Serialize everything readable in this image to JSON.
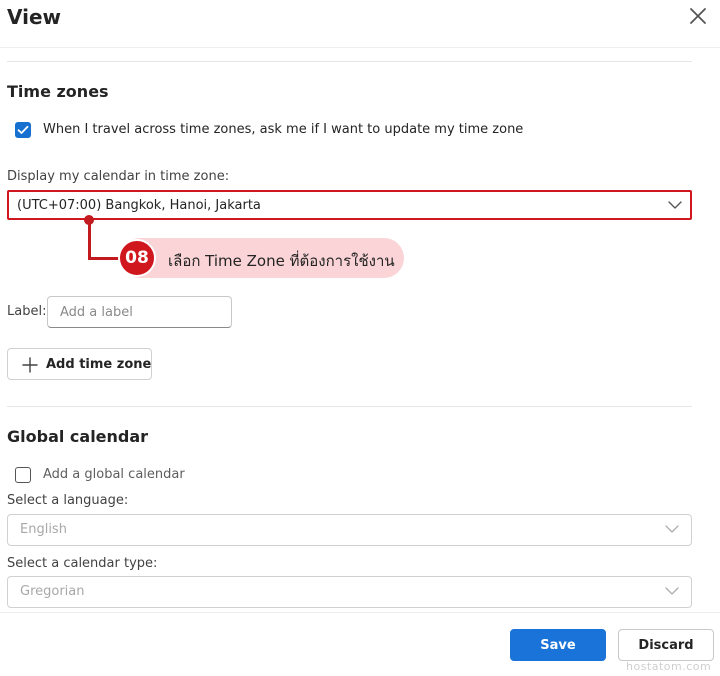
{
  "dialog": {
    "title": "View",
    "close_icon": "close-icon"
  },
  "time_zones": {
    "heading": "Time zones",
    "travel_checkbox": {
      "label": "When I travel across time zones, ask me if I want to update my time zone",
      "checked": true
    },
    "display_label": "Display my calendar in time zone:",
    "selected_time_zone": "(UTC+07:00) Bangkok, Hanoi, Jakarta",
    "label_field": {
      "label": "Label:",
      "placeholder": "Add a label",
      "value": ""
    },
    "add_button_label": "Add time zone"
  },
  "annotation": {
    "step": "08",
    "text": "เลือก Time Zone ที่ต้องการใช้งาน",
    "color": "#d0171e"
  },
  "global_calendar": {
    "heading": "Global calendar",
    "add_checkbox": {
      "label": "Add a global calendar",
      "checked": false
    },
    "language_label": "Select a language:",
    "language_value": "English",
    "type_label": "Select a calendar type:",
    "type_value": "Gregorian"
  },
  "footer": {
    "save_label": "Save",
    "discard_label": "Discard",
    "primary_color": "#1a73d9"
  },
  "watermark": "hostatom.com"
}
